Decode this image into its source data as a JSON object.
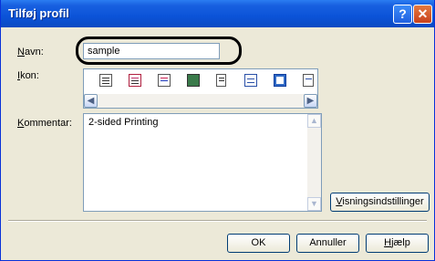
{
  "window": {
    "title": "Tilføj profil"
  },
  "titlebar": {
    "help_glyph": "?",
    "close_glyph": "✕"
  },
  "form": {
    "name_label_u": "N",
    "name_label_rest": "avn:",
    "name_value": "sample",
    "icon_label_u": "I",
    "icon_label_rest": "kon:",
    "comment_label_u": "K",
    "comment_label_rest": "ommentar:",
    "comment_value": "2-sided Printing"
  },
  "icons": [
    "document-icon",
    "colored-document-icon",
    "xps-document-icon",
    "photo-icon",
    "portrait-document-icon",
    "two-page-icon",
    "booklet-icon",
    "a4-paper-icon"
  ],
  "selected_icon_index": 6,
  "buttons": {
    "view_settings_u": "V",
    "view_settings_rest": "isningsindstillinger",
    "ok": "OK",
    "cancel": "Annuller",
    "help_u": "H",
    "help_rest": "jælp"
  }
}
